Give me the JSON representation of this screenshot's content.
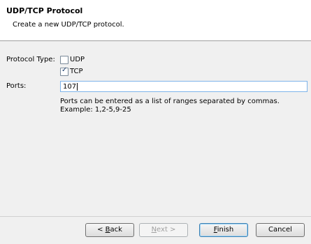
{
  "header": {
    "title": "UDP/TCP Protocol",
    "description": "Create a new UDP/TCP protocol."
  },
  "form": {
    "protocol_type_label": "Protocol Type:",
    "udp": {
      "label": "UDP",
      "checked": false
    },
    "tcp": {
      "label": "TCP",
      "checked": true
    },
    "ports_label": "Ports:",
    "ports_value": "107",
    "help_line1": "Ports can be entered as a list of ranges separated by commas.",
    "help_line2": "Example: 1,2-5,9-25"
  },
  "buttons": {
    "back_prefix": "< ",
    "back_mnemonic": "B",
    "back_rest": "ack",
    "next_mnemonic": "N",
    "next_rest": "ext >",
    "finish_mnemonic": "F",
    "finish_rest": "inish",
    "cancel": "Cancel"
  }
}
